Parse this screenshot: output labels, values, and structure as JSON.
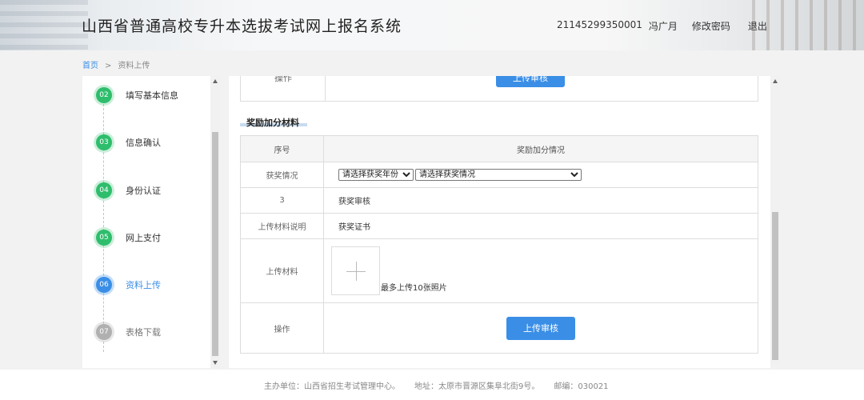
{
  "header": {
    "title": "山西省普通高校专升本选拔考试网上报名系统",
    "user_id": "21145299350001",
    "user_name": "冯广月",
    "change_password": "修改密码",
    "logout": "退出"
  },
  "breadcrumb": {
    "home": "首页",
    "separator": ">",
    "current": "资料上传"
  },
  "sidebar": {
    "steps": [
      {
        "num": "02",
        "label": "填写基本信息",
        "state": "done"
      },
      {
        "num": "03",
        "label": "信息确认",
        "state": "done"
      },
      {
        "num": "04",
        "label": "身份认证",
        "state": "done"
      },
      {
        "num": "05",
        "label": "网上支付",
        "state": "done"
      },
      {
        "num": "06",
        "label": "资料上传",
        "state": "active"
      },
      {
        "num": "07",
        "label": "表格下载",
        "state": "pending"
      }
    ]
  },
  "main": {
    "previous": {
      "op_label": "操作",
      "button": "上传审核"
    },
    "section_title": "奖励加分材料",
    "table": {
      "col_seq": "序号",
      "col_info": "奖励加分情况",
      "award_label": "获奖情况",
      "year_select": "请选择获奖年份",
      "award_select": "请选择获奖情况",
      "seq_value": "3",
      "seq_text": "获奖审核",
      "desc_label": "上传材料说明",
      "desc_value": "获奖证书",
      "upload_label": "上传材料",
      "upload_hint": "最多上传10张照片",
      "op_label": "操作",
      "submit_button": "上传审核"
    }
  },
  "footer": {
    "host": "主办单位：山西省招生考试管理中心。",
    "address": "地址：太原市晋源区集阜北街9号。",
    "postcode": "邮编：030021"
  },
  "colors": {
    "accent": "#3a8ee6",
    "done": "#2ebd6c",
    "pending": "#b0b0b0"
  }
}
